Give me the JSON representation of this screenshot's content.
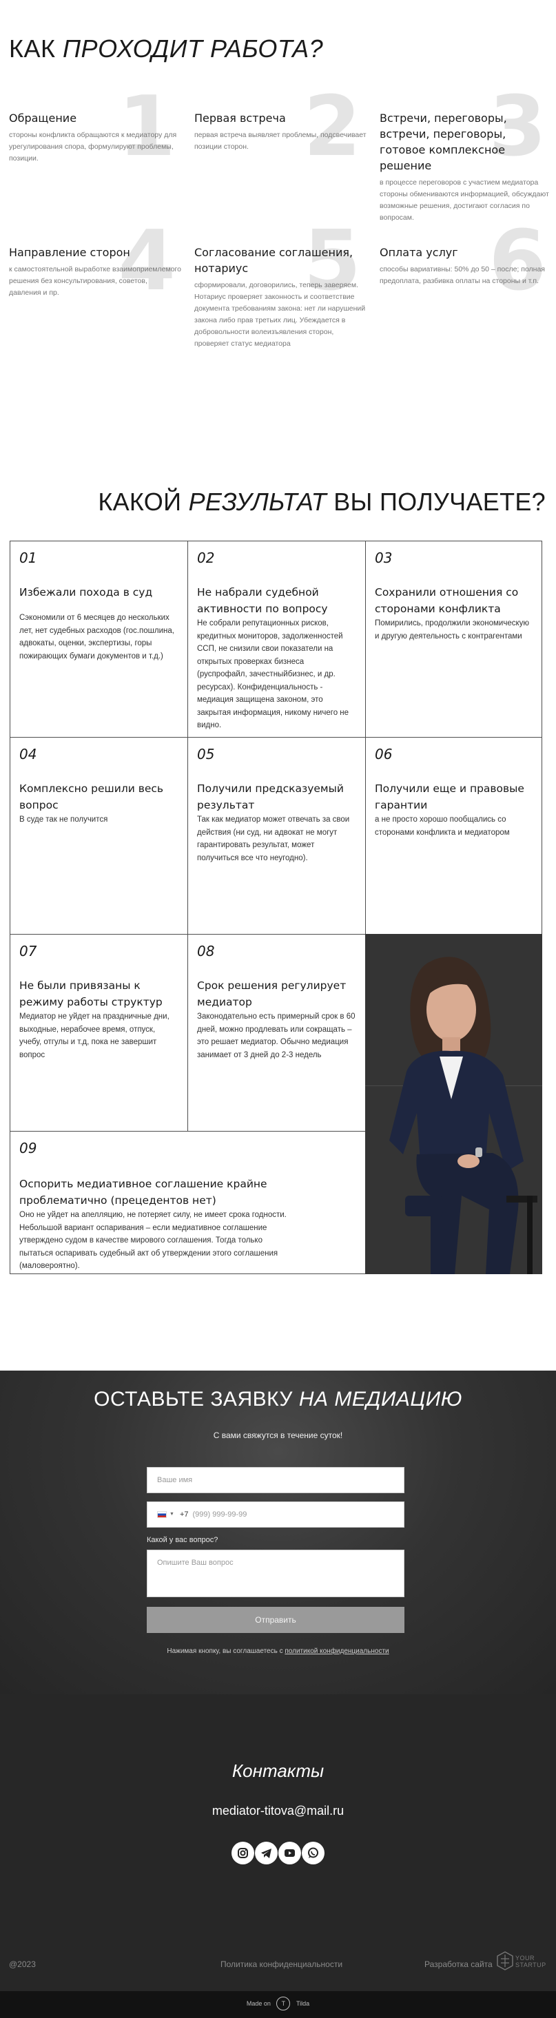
{
  "process": {
    "title_plain": "КАК ",
    "title_italic": "ПРОХОДИТ РАБОТА?",
    "steps": [
      {
        "num": "1",
        "title": "Обращение",
        "text": "стороны конфликта обращаются к медиатору для урегулирования спора, формулируют проблемы, позиции."
      },
      {
        "num": "2",
        "title": "Первая встреча",
        "text": "первая встреча выявляет проблемы, подсвечивает позиции сторон."
      },
      {
        "num": "3",
        "title": "Встречи, переговоры, встречи, переговоры, готовое комплексное решение",
        "text": "в процессе переговоров с участием медиатора стороны обмениваются информацией, обсуждают возможные решения, достигают согласия по вопросам."
      },
      {
        "num": "4",
        "title": "Направление сторон",
        "text": "к самостоятельной выработке взаимоприемлемого решения без консультирования, советов, давления и пр."
      },
      {
        "num": "5",
        "title": "Согласование соглашения, нотариус",
        "text": "сформировали, договорились, теперь заверяем. Нотариус проверяет законность и соответствие документа требованиям закона: нет ли нарушений закона либо прав третьих лиц. Убеждается в добровольности волеизъявления сторон, проверяет статус медиатора"
      },
      {
        "num": "6",
        "title": "Оплата услуг",
        "text": "способы вариативны: 50% до 50 – после; полная предоплата, разбивка оплаты на стороны и т.п."
      }
    ]
  },
  "result": {
    "title_pre": "КАКОЙ ",
    "title_italic": "РЕЗУЛЬТАТ",
    "title_post": " ВЫ ПОЛУЧАЕТЕ?",
    "items": [
      {
        "num": "01",
        "title": "Избежали похода в суд",
        "text": "Сэкономили от 6 месяцев до нескольких лет, нет судебных расходов (гос.пошлина, адвокаты, оценки, экспертизы, горы пожирающих бумаги документов и т.д.)"
      },
      {
        "num": "02",
        "title": "Не набрали судебной активности по вопросу",
        "text": "Не собрали репутационных рисков, кредитных мониторов, задолженностей ССП, не снизили свои показатели на открытых проверках бизнеса (руспрофайл, зачестныйбизнес, и др. ресурсах). Конфиденциальность - медиация защищена законом, это закрытая информация, никому ничего не видно."
      },
      {
        "num": "03",
        "title": "Сохранили отношения со сторонами конфликта",
        "text": "Помирились, продолжили экономическую и другую деятельность с контрагентами"
      },
      {
        "num": "04",
        "title": "Комплексно решили весь вопрос",
        "text": "В суде так не получится"
      },
      {
        "num": "05",
        "title": "Получили предсказуемый результат",
        "text": "Так как медиатор может отвечать за свои действия (ни суд, ни адвокат не могут гарантировать результат, может получиться все что неугодно)."
      },
      {
        "num": "06",
        "title": "Получили еще и правовые гарантии",
        "text": "а не просто хорошо пообщались со сторонами конфликта и медиатором"
      },
      {
        "num": "07",
        "title": "Не были привязаны к режиму работы структур",
        "text": "Медиатор не уйдет на праздничные дни, выходные, нерабочее время, отпуск, учебу, отгулы и т.д, пока не завершит вопрос"
      },
      {
        "num": "08",
        "title": "Срок решения регулирует медиатор",
        "text": "Законодательно есть примерный срок в 60 дней, можно продлевать или сокращать – это решает медиатор. Обычно медиация занимает от 3 дней до 2-3 недель"
      },
      {
        "num": "09",
        "title": "Оспорить медиативное соглашение крайне проблематично (прецедентов нет)",
        "text": "Оно не уйдет на апелляцию, не потеряет силу, не имеет срока годности. Небольшой вариант оспаривания – если медиативное соглашение утверждено судом в качестве мирового соглашения. Тогда только пытаться оспаривать судебный акт об утверждении этого соглашения (маловероятно)."
      }
    ]
  },
  "form": {
    "title_plain": "ОСТАВЬТЕ ЗАЯВКУ ",
    "title_italic": "НА МЕДИАЦИЮ",
    "subtitle": "С вами свяжутся в течение суток!",
    "name_placeholder": "Ваше имя",
    "phone_prefix": "+7",
    "phone_placeholder": "(999) 999-99-99",
    "question_label": "Какой у вас вопрос?",
    "question_placeholder": "Опишите Ваш вопрос",
    "submit_label": "Отправить",
    "consent_text": "Нажимая кнопку, вы соглашаетесь с ",
    "consent_link": "политикой конфиденциальности"
  },
  "contacts": {
    "title": "Контакты",
    "email": "mediator-titova@mail.ru",
    "socials": [
      "instagram-icon",
      "telegram-icon",
      "youtube-icon",
      "whatsapp-icon"
    ]
  },
  "footer": {
    "copyright": "@2023",
    "privacy": "Политика конфиденциальности",
    "developer": "Разработка сайта",
    "dev_brand_line1": "YOUR",
    "dev_brand_line2": "STARTUP",
    "made_on": "Made on",
    "made_brand": "Tilda"
  },
  "colors": {
    "dark_section": "#333333",
    "footer_bg": "#272727",
    "bottom_bar": "#121212",
    "button_gray": "#9a9a9a",
    "number_gray": "#e4e4e4"
  }
}
